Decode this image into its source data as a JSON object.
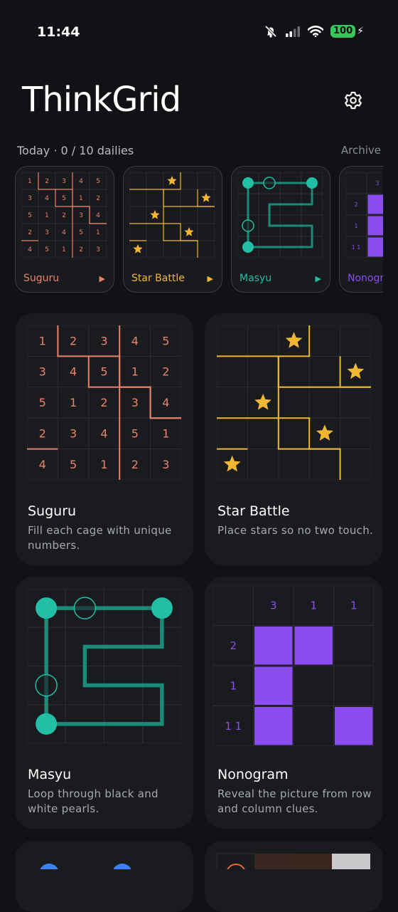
{
  "status_bar": {
    "time": "11:44",
    "battery": "100"
  },
  "app": {
    "title": "ThinkGrid"
  },
  "dailies": {
    "label": "Today · 0 / 10 dailies",
    "archive_label": "Archive"
  },
  "daily_cards": [
    {
      "name": "Suguru",
      "color": "#e8836a"
    },
    {
      "name": "Star Battle",
      "color": "#f1b733"
    },
    {
      "name": "Masyu",
      "color": "#22bfa6"
    },
    {
      "name": "Nonogram",
      "color": "#8b4cf0"
    }
  ],
  "puzzles": [
    {
      "title": "Suguru",
      "description": "Fill each cage with unique numbers."
    },
    {
      "title": "Star Battle",
      "description": "Place stars so no two touch."
    },
    {
      "title": "Masyu",
      "description": "Loop through black and white pearls."
    },
    {
      "title": "Nonogram",
      "description": "Reveal the picture from row and column clues."
    }
  ],
  "suguru_grid": [
    [
      "1",
      "2",
      "3",
      "4",
      "5"
    ],
    [
      "3",
      "4",
      "5",
      "1",
      "2"
    ],
    [
      "5",
      "1",
      "2",
      "3",
      "4"
    ],
    [
      "2",
      "3",
      "4",
      "5",
      "1"
    ],
    [
      "4",
      "5",
      "1",
      "2",
      "3"
    ]
  ],
  "nonogram_clues": {
    "columns": [
      "3",
      "1",
      "1"
    ],
    "rows": [
      "2",
      "1",
      "1 1"
    ]
  },
  "icons": {
    "settings": "gear-icon",
    "mute": "bell-slash-icon",
    "signal": "signal-icon",
    "wifi": "wifi-icon"
  }
}
